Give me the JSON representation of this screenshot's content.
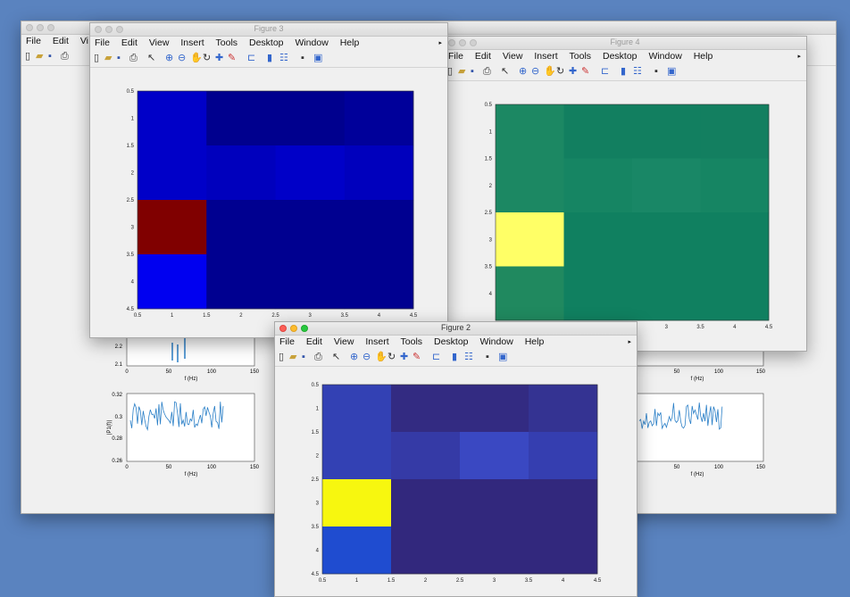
{
  "figure_back": {
    "title": "",
    "menu_items": [
      "File",
      "Edit",
      "Vi"
    ],
    "fft_plots": [
      {
        "xlabel": "f (Hz)",
        "xticks": [
          "0",
          "50",
          "100",
          "150"
        ],
        "yticks": [
          "2.1",
          "2.2"
        ]
      },
      {
        "xlabel": "f (Hz)",
        "xticks": [
          "0",
          "50",
          "100",
          "150"
        ],
        "yticks": [
          "0.26",
          "0.28",
          "0.3",
          "0.32"
        ],
        "ylabel": "|P1(f)|"
      }
    ],
    "fft_plots_right": [
      {
        "xlabel": "f (Hz)",
        "xticks": [
          "50",
          "100",
          "150"
        ]
      },
      {
        "xlabel": "f (Hz)",
        "xticks": [
          "50",
          "100",
          "150"
        ]
      }
    ]
  },
  "figure3": {
    "title": "Figure 3",
    "menu_items": [
      "File",
      "Edit",
      "View",
      "Insert",
      "Tools",
      "Desktop",
      "Window",
      "Help"
    ]
  },
  "figure4": {
    "title": "Figure 4",
    "menu_items": [
      "File",
      "Edit",
      "View",
      "Insert",
      "Tools",
      "Desktop",
      "Window",
      "Help"
    ]
  },
  "figure2": {
    "title": "Figure 2",
    "menu_items": [
      "File",
      "Edit",
      "View",
      "Insert",
      "Tools",
      "Desktop",
      "Window",
      "Help"
    ]
  },
  "chart_data": [
    {
      "figure": "Figure 3",
      "type": "heatmap",
      "colormap": "jet",
      "x": [
        1,
        2,
        3,
        4
      ],
      "y": [
        1,
        2,
        3,
        4
      ],
      "xticks": [
        "0.5",
        "1",
        "1.5",
        "2",
        "2.5",
        "3",
        "3.5",
        "4",
        "4.5"
      ],
      "yticks": [
        "0.5",
        "1",
        "1.5",
        "2",
        "2.5",
        "3",
        "3.5",
        "4",
        "4.5"
      ],
      "xlim": [
        0.5,
        4.5
      ],
      "ylim": [
        0.5,
        4.5
      ],
      "colors": [
        [
          "#0000c8",
          "#00008e",
          "#00008e",
          "#00009a"
        ],
        [
          "#0000c8",
          "#0000bd",
          "#0000c8",
          "#0000bd"
        ],
        [
          "#800000",
          "#000090",
          "#000090",
          "#000090"
        ],
        [
          "#0000f0",
          "#000090",
          "#000090",
          "#000090"
        ]
      ]
    },
    {
      "figure": "Figure 4",
      "type": "heatmap",
      "colormap": "summer",
      "x": [
        1,
        2,
        3,
        4
      ],
      "y": [
        1,
        2,
        3,
        4
      ],
      "yticks": [
        "0.5",
        "1",
        "1.5",
        "2",
        "2.5",
        "3",
        "3.5",
        "4"
      ],
      "xticks": [
        "3",
        "3.5",
        "4",
        "4.5"
      ],
      "xlim": [
        0.5,
        4.5
      ],
      "ylim": [
        0.5,
        4.5
      ],
      "colors": [
        [
          "#1c8863",
          "#127f60",
          "#127f60",
          "#137f60"
        ],
        [
          "#1c8863",
          "#168563",
          "#198766",
          "#168563"
        ],
        [
          "#ffff66",
          "#108060",
          "#108060",
          "#108060"
        ],
        [
          "#20895f",
          "#108060",
          "#108060",
          "#108060"
        ]
      ]
    },
    {
      "figure": "Figure 2",
      "type": "heatmap",
      "colormap": "parula",
      "x": [
        1,
        2,
        3,
        4
      ],
      "y": [
        1,
        2,
        3,
        4
      ],
      "xticks": [
        "0.5",
        "1",
        "1.5",
        "2",
        "2.5",
        "3",
        "3.5",
        "4",
        "4.5"
      ],
      "yticks": [
        "0.5",
        "1",
        "1.5",
        "2",
        "2.5",
        "3",
        "3.5",
        "4",
        "4.5"
      ],
      "xlim": [
        0.5,
        4.5
      ],
      "ylim": [
        0.5,
        4.5
      ],
      "colors": [
        [
          "#3341b4",
          "#332b82",
          "#332b82",
          "#343392"
        ],
        [
          "#3341b4",
          "#353aa6",
          "#3a48c2",
          "#353eb0"
        ],
        [
          "#f7f70f",
          "#32287d",
          "#32287d",
          "#32287d"
        ],
        [
          "#1f4cd0",
          "#32287d",
          "#32287d",
          "#32287d"
        ]
      ]
    }
  ]
}
